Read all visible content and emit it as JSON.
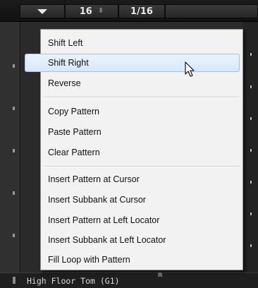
{
  "toolbar": {
    "steps_value": "16",
    "resolution_value": "1/16"
  },
  "menu": {
    "items": [
      {
        "label": "Shift Left"
      },
      {
        "label": "Shift Right"
      },
      {
        "label": "Reverse"
      },
      {
        "label": "Copy Pattern"
      },
      {
        "label": "Paste Pattern"
      },
      {
        "label": "Clear Pattern"
      },
      {
        "label": "Insert Pattern at Cursor"
      },
      {
        "label": "Insert Subbank at Cursor"
      },
      {
        "label": "Insert Pattern at Left Locator"
      },
      {
        "label": "Insert Subbank at Left Locator"
      },
      {
        "label": "Fill Loop with Pattern"
      }
    ],
    "highlighted": "Shift Right"
  },
  "background": {
    "row_label": "High Floor Tom (G1)",
    "row_marker": "m"
  },
  "colors": {
    "highlight": "#d7e8fb",
    "menu_bg": "#f2f2f2"
  },
  "icons": {
    "dropdown": "triangle-down-icon",
    "spinner": "spinner-arrows-icon",
    "cursor": "mouse-pointer-icon"
  }
}
